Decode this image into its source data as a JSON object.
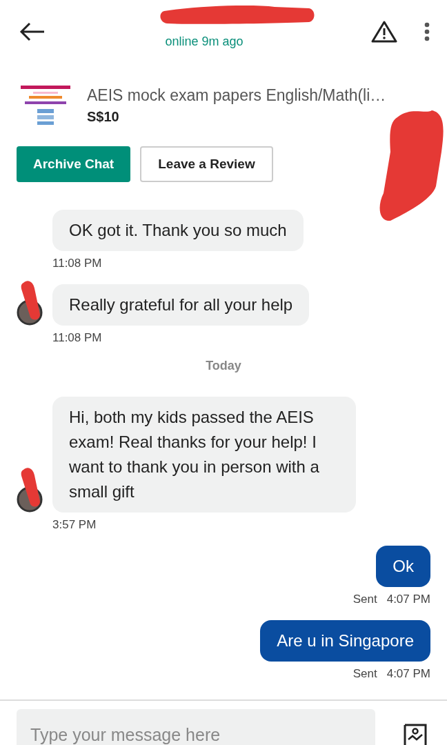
{
  "header": {
    "status": "online 9m ago"
  },
  "listing": {
    "title": "AEIS mock exam papers English/Math(li…",
    "price": "S$10"
  },
  "actions": [
    {
      "label": "Archive Chat",
      "kind": "primary"
    },
    {
      "label": "Leave a Review",
      "kind": "secondary"
    }
  ],
  "items": [
    {
      "kind": "incoming",
      "avatar": false,
      "text": "OK got it. Thank you so much",
      "time": "11:08 PM"
    },
    {
      "kind": "incoming",
      "avatar": true,
      "text": "Really grateful for all your help",
      "time": "11:08 PM"
    },
    {
      "kind": "divider",
      "text": "Today"
    },
    {
      "kind": "incoming",
      "avatar": true,
      "text": "Hi, both my kids passed the AEIS exam! Real thanks for your help! I want to thank you in person with a small gift",
      "time": "3:57 PM"
    },
    {
      "kind": "outgoing",
      "text": "Ok",
      "status": "Sent",
      "time": "4:07 PM"
    },
    {
      "kind": "outgoing",
      "text": "Are u in Singapore",
      "status": "Sent",
      "time": "4:07 PM"
    }
  ],
  "composer": {
    "placeholder": "Type your message here"
  }
}
